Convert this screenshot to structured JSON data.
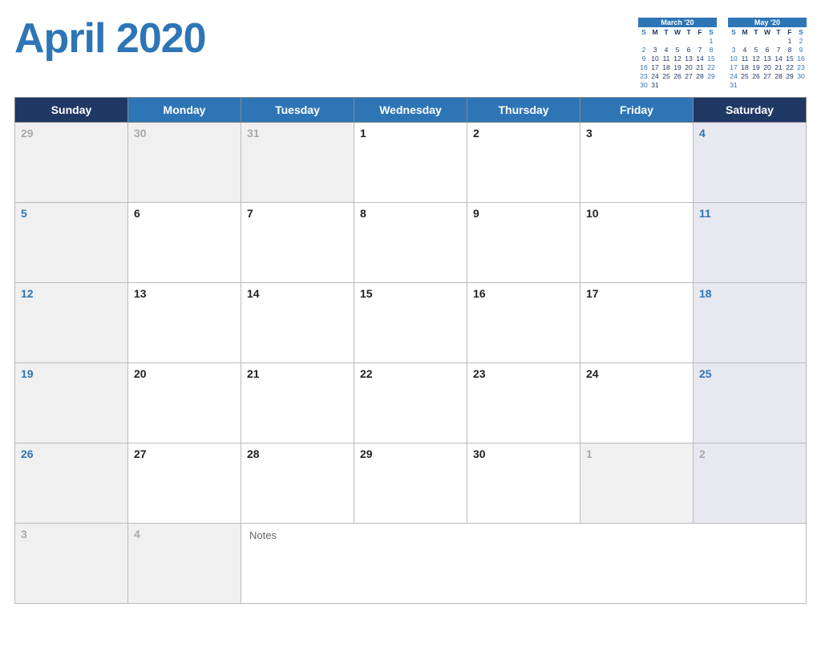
{
  "header": {
    "title": "April 2020"
  },
  "mini_march": {
    "title": "March '20",
    "days_header": [
      "S",
      "M",
      "T",
      "W",
      "T",
      "F",
      "S"
    ],
    "weeks": [
      [
        "",
        "",
        "",
        "",
        "",
        "",
        "1"
      ],
      [
        "2",
        "3",
        "4",
        "5",
        "6",
        "7",
        "8"
      ],
      [
        "9",
        "10",
        "11",
        "12",
        "13",
        "14",
        "15"
      ],
      [
        "16",
        "17",
        "18",
        "19",
        "20",
        "21",
        "22"
      ],
      [
        "23",
        "24",
        "25",
        "26",
        "27",
        "28",
        "29"
      ],
      [
        "30",
        "31",
        "",
        "",
        "",
        "",
        ""
      ]
    ]
  },
  "mini_may": {
    "title": "May '20",
    "days_header": [
      "S",
      "M",
      "T",
      "W",
      "T",
      "F",
      "S"
    ],
    "weeks": [
      [
        "",
        "",
        "",
        "",
        "",
        "1",
        "2"
      ],
      [
        "3",
        "4",
        "5",
        "6",
        "7",
        "8",
        "9"
      ],
      [
        "10",
        "11",
        "12",
        "13",
        "14",
        "15",
        "16"
      ],
      [
        "17",
        "18",
        "19",
        "20",
        "21",
        "22",
        "23"
      ],
      [
        "24",
        "25",
        "26",
        "27",
        "28",
        "29",
        "30"
      ],
      [
        "31",
        "",
        "",
        "",
        "",
        "",
        ""
      ]
    ]
  },
  "calendar": {
    "weekdays": [
      "Sunday",
      "Monday",
      "Tuesday",
      "Wednesday",
      "Thursday",
      "Friday",
      "Saturday"
    ],
    "rows": [
      [
        {
          "day": "29",
          "type": "prev",
          "color": "gray"
        },
        {
          "day": "30",
          "type": "prev",
          "color": "gray"
        },
        {
          "day": "31",
          "type": "prev",
          "color": "gray"
        },
        {
          "day": "1",
          "type": "current",
          "color": "normal"
        },
        {
          "day": "2",
          "type": "current",
          "color": "normal"
        },
        {
          "day": "3",
          "type": "current",
          "color": "normal"
        },
        {
          "day": "4",
          "type": "current",
          "color": "blue"
        }
      ],
      [
        {
          "day": "5",
          "type": "current",
          "color": "blue"
        },
        {
          "day": "6",
          "type": "current",
          "color": "normal"
        },
        {
          "day": "7",
          "type": "current",
          "color": "normal"
        },
        {
          "day": "8",
          "type": "current",
          "color": "normal"
        },
        {
          "day": "9",
          "type": "current",
          "color": "normal"
        },
        {
          "day": "10",
          "type": "current",
          "color": "normal"
        },
        {
          "day": "11",
          "type": "current",
          "color": "blue"
        }
      ],
      [
        {
          "day": "12",
          "type": "current",
          "color": "blue"
        },
        {
          "day": "13",
          "type": "current",
          "color": "normal"
        },
        {
          "day": "14",
          "type": "current",
          "color": "normal"
        },
        {
          "day": "15",
          "type": "current",
          "color": "normal"
        },
        {
          "day": "16",
          "type": "current",
          "color": "normal"
        },
        {
          "day": "17",
          "type": "current",
          "color": "normal"
        },
        {
          "day": "18",
          "type": "current",
          "color": "blue"
        }
      ],
      [
        {
          "day": "19",
          "type": "current",
          "color": "blue"
        },
        {
          "day": "20",
          "type": "current",
          "color": "normal"
        },
        {
          "day": "21",
          "type": "current",
          "color": "normal"
        },
        {
          "day": "22",
          "type": "current",
          "color": "normal"
        },
        {
          "day": "23",
          "type": "current",
          "color": "normal"
        },
        {
          "day": "24",
          "type": "current",
          "color": "normal"
        },
        {
          "day": "25",
          "type": "current",
          "color": "blue"
        }
      ],
      [
        {
          "day": "26",
          "type": "current",
          "color": "blue"
        },
        {
          "day": "27",
          "type": "current",
          "color": "normal"
        },
        {
          "day": "28",
          "type": "current",
          "color": "normal"
        },
        {
          "day": "29",
          "type": "current",
          "color": "normal"
        },
        {
          "day": "30",
          "type": "current",
          "color": "normal"
        },
        {
          "day": "1",
          "type": "next",
          "color": "gray"
        },
        {
          "day": "2",
          "type": "next",
          "color": "gray"
        }
      ]
    ],
    "last_row": {
      "cells": [
        {
          "day": "3",
          "type": "next",
          "color": "gray"
        },
        {
          "day": "4",
          "type": "next",
          "color": "gray"
        }
      ],
      "notes_label": "Notes"
    }
  }
}
